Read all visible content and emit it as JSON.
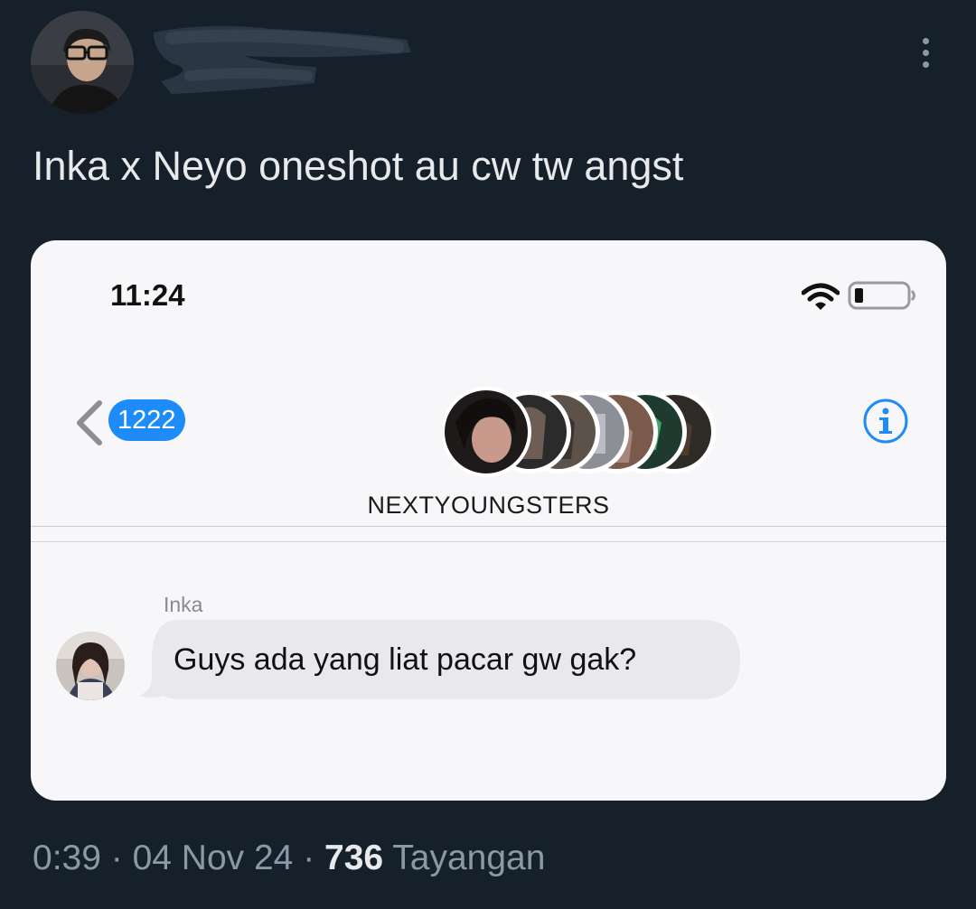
{
  "tweet": {
    "text": "Inka x Neyo oneshot au cw tw angst",
    "more_icon": "more-horizontal-icon"
  },
  "screenshot": {
    "status_time": "11:24",
    "back_badge": "1222",
    "group_name": "NEXTYOUNGSTERS",
    "sender_name": "Inka",
    "message": "Guys ada yang liat pacar gw gak?",
    "colors": {
      "badge": "#1d8cf8",
      "bubble": "#e8e8ed",
      "info": "#1d8cf8"
    }
  },
  "meta": {
    "time": "0:39",
    "sep1": " · ",
    "date": "04 Nov 24",
    "sep2": " · ",
    "views": "736",
    "views_label": " Tayangan"
  },
  "colors": {
    "background": "#15202b",
    "text": "#e7e9ea",
    "muted": "#8b98a5"
  }
}
